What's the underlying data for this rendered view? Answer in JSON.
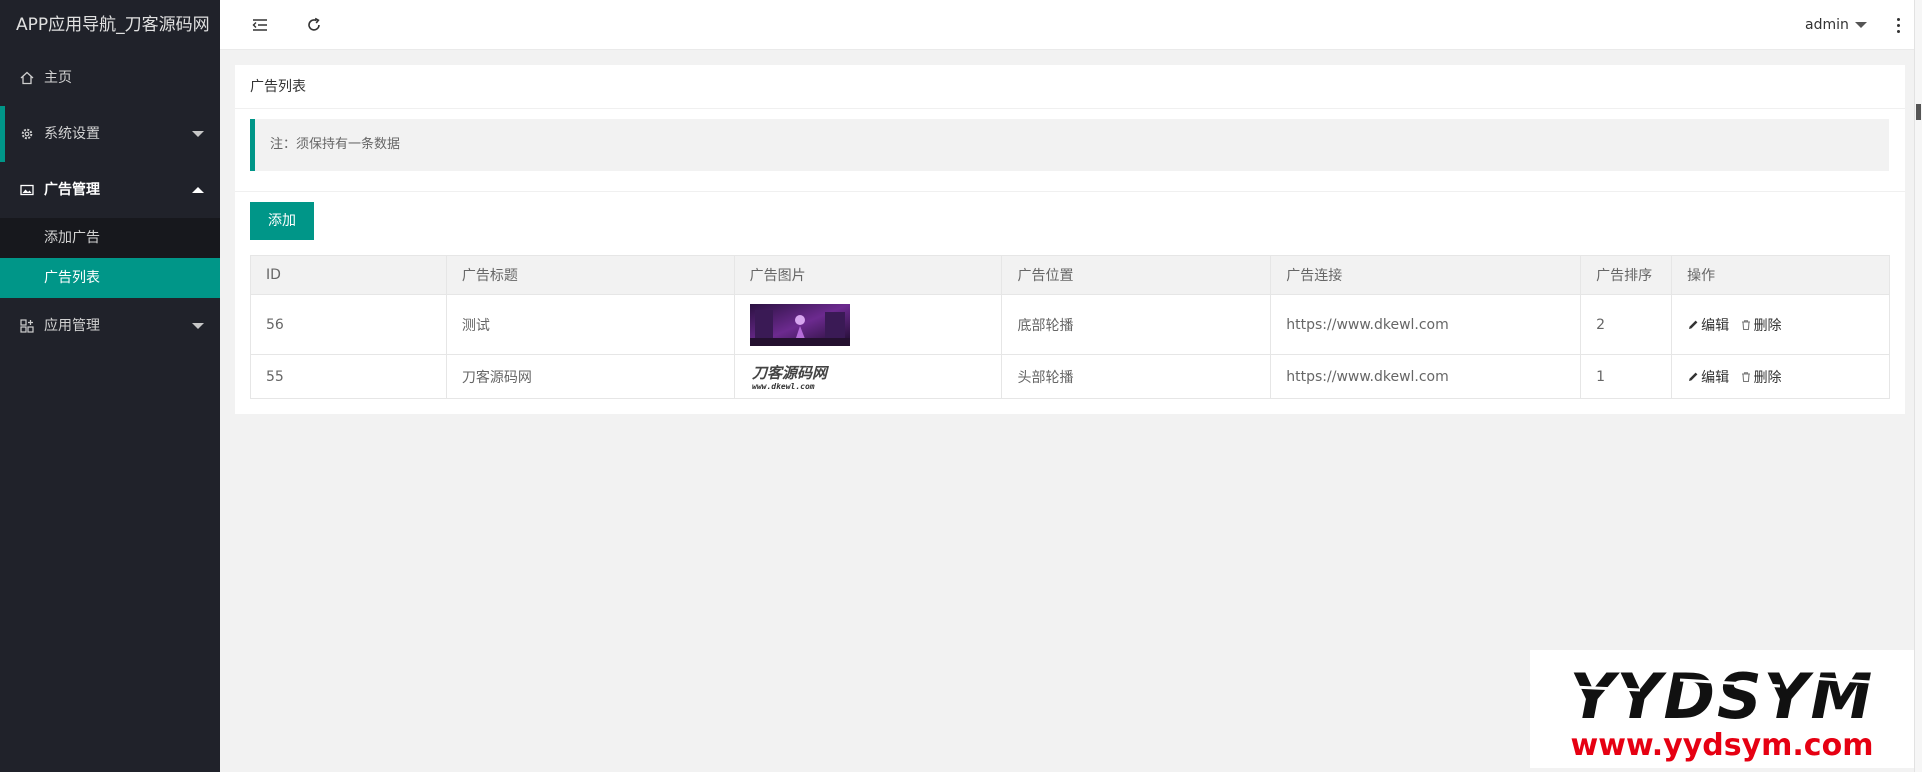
{
  "app_title": "APP应用导航_刀客源码网",
  "sidebar": {
    "home": "主页",
    "system_settings": "系统设置",
    "ad_management": "广告管理",
    "ad_sub": [
      "添加广告",
      "广告列表"
    ],
    "app_management": "应用管理"
  },
  "header": {
    "user": "admin"
  },
  "card": {
    "title": "广告列表",
    "notice": "注：须保持有一条数据",
    "add_button": "添加"
  },
  "table": {
    "columns": [
      "ID",
      "广告标题",
      "广告图片",
      "广告位置",
      "广告连接",
      "广告排序",
      "操作"
    ],
    "rows": [
      {
        "id": "56",
        "title": "测试",
        "position": "底部轮播",
        "link": "https://www.dkewl.com",
        "sort": "2",
        "image_label": ""
      },
      {
        "id": "55",
        "title": "刀客源码网",
        "position": "头部轮播",
        "link": "https://www.dkewl.com",
        "sort": "1",
        "image_label": "刀客源码网",
        "image_sub": "www.dkewl.com"
      }
    ],
    "actions": {
      "edit": "编辑",
      "delete": "删除"
    }
  },
  "watermark": {
    "brand": "YYDSYM",
    "url": "www.yydsym.com"
  },
  "colors": {
    "accent": "#009688",
    "sidebar_bg": "#20222a",
    "watermark_red": "#e60012"
  },
  "icons": [
    "home-icon",
    "gear-icon",
    "image-icon",
    "apps-icon",
    "menu-fold-icon",
    "refresh-icon",
    "more-vertical-icon",
    "edit-icon",
    "delete-icon"
  ]
}
